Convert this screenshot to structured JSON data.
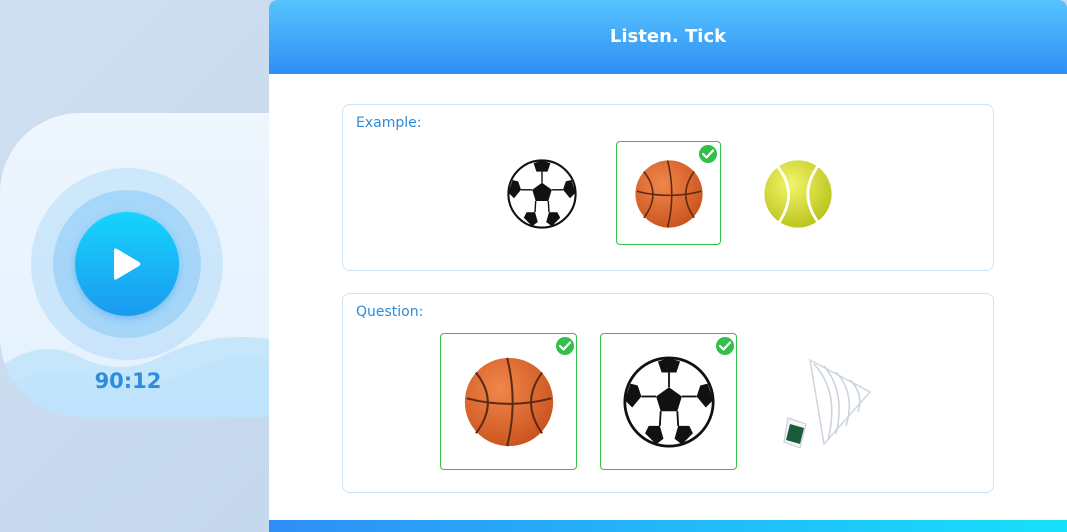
{
  "audio": {
    "timer": "90:12",
    "icon": "play-icon",
    "accent": "#1a9af0"
  },
  "card": {
    "title": "Listen. Tick",
    "header_color": "#2f8ef6"
  },
  "example": {
    "label": "Example:",
    "options": [
      {
        "name": "soccer-ball",
        "selected": false
      },
      {
        "name": "basketball",
        "selected": true
      },
      {
        "name": "tennis-ball",
        "selected": false
      }
    ]
  },
  "question": {
    "label": "Question:",
    "options": [
      {
        "name": "basketball",
        "selected": true
      },
      {
        "name": "soccer-ball",
        "selected": true
      },
      {
        "name": "shuttlecock",
        "selected": false
      }
    ]
  },
  "colors": {
    "check_green": "#33c04a",
    "label_blue": "#2d8bdc"
  }
}
